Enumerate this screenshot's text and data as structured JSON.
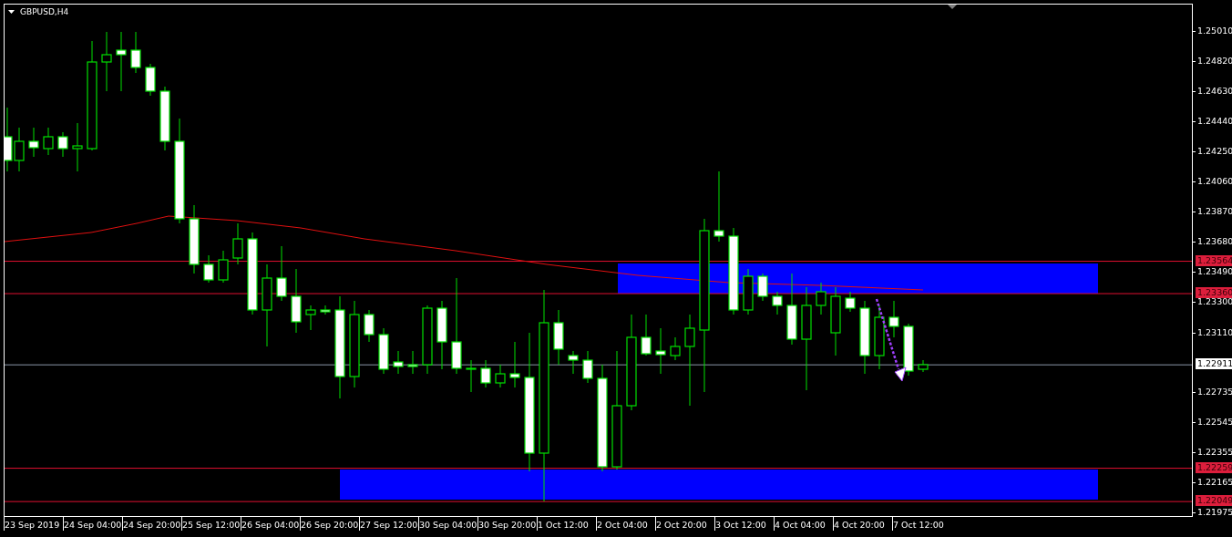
{
  "chart": {
    "title": "GBPUSD,H4",
    "price_axis": [
      {
        "label": "1.25010",
        "kind": "tick"
      },
      {
        "label": "1.24820",
        "kind": "tick"
      },
      {
        "label": "1.24630",
        "kind": "tick"
      },
      {
        "label": "1.24440",
        "kind": "tick"
      },
      {
        "label": "1.24250",
        "kind": "tick"
      },
      {
        "label": "1.24060",
        "kind": "tick"
      },
      {
        "label": "1.23870",
        "kind": "tick"
      },
      {
        "label": "1.23680",
        "kind": "tick"
      },
      {
        "label": "1.23564",
        "kind": "level"
      },
      {
        "label": "1.23490",
        "kind": "tick"
      },
      {
        "label": "1.23360",
        "kind": "level"
      },
      {
        "label": "1.23300",
        "kind": "tick"
      },
      {
        "label": "1.23110",
        "kind": "tick"
      },
      {
        "label": "1.22911",
        "kind": "current"
      },
      {
        "label": "1.22735",
        "kind": "tick"
      },
      {
        "label": "1.22545",
        "kind": "tick"
      },
      {
        "label": "1.22355",
        "kind": "tick"
      },
      {
        "label": "1.22259",
        "kind": "level"
      },
      {
        "label": "1.22165",
        "kind": "tick"
      },
      {
        "label": "1.22049",
        "kind": "level"
      },
      {
        "label": "1.21975",
        "kind": "tick"
      }
    ],
    "time_axis": [
      "23 Sep 2019",
      "24 Sep 04:00",
      "24 Sep 20:00",
      "25 Sep 12:00",
      "26 Sep 04:00",
      "26 Sep 20:00",
      "27 Sep 12:00",
      "30 Sep 04:00",
      "30 Sep 20:00",
      "1 Oct 12:00",
      "2 Oct 04:00",
      "2 Oct 20:00",
      "3 Oct 12:00",
      "4 Oct 04:00",
      "4 Oct 20:00",
      "7 Oct 12:00"
    ]
  }
}
